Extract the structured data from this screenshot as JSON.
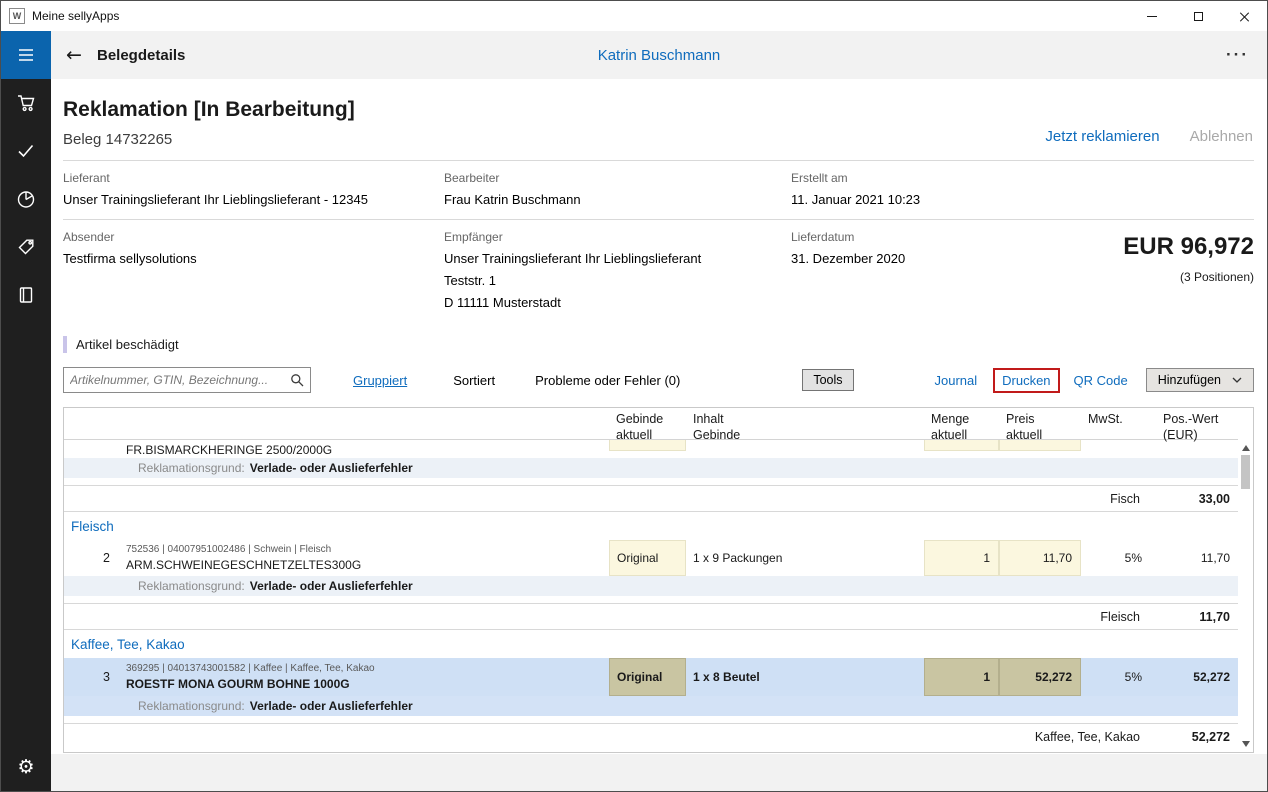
{
  "titlebar": {
    "app_icon": "W",
    "title": "Meine sellyApps"
  },
  "header": {
    "back": "←",
    "title": "Belegdetails",
    "user": "Katrin Buschmann",
    "more": "···"
  },
  "doc": {
    "title": "Reklamation [In Bearbeitung]",
    "beleg": "Beleg 14732265",
    "action_primary": "Jetzt reklamieren",
    "action_secondary": "Ablehnen",
    "note": "Artikel beschädigt",
    "total": "EUR 96,972",
    "total_positions": "(3 Positionen)",
    "fields": {
      "lieferant": {
        "label": "Lieferant",
        "value": "Unser Trainingslieferant Ihr Lieblingslieferant - 12345"
      },
      "bearbeiter": {
        "label": "Bearbeiter",
        "value": "Frau Katrin Buschmann"
      },
      "erstellt": {
        "label": "Erstellt am",
        "value": "11. Januar 2021 10:23"
      },
      "absender": {
        "label": "Absender",
        "value": "Testfirma sellysolutions"
      },
      "empfaenger": {
        "label": "Empfänger",
        "line1": "Unser Trainingslieferant Ihr Lieblingslieferant",
        "line2": "Teststr. 1",
        "line3": "D 11111 Musterstadt"
      },
      "lieferdatum": {
        "label": "Lieferdatum",
        "value": "31. Dezember 2020"
      }
    }
  },
  "toolbar": {
    "search_placeholder": "Artikelnummer, GTIN, Bezeichnung...",
    "gruppiert": "Gruppiert",
    "sortiert": "Sortiert",
    "probleme": "Probleme oder Fehler (0)",
    "tools": "Tools",
    "journal": "Journal",
    "drucken": "Drucken",
    "qr_code": "QR Code",
    "hinzufuegen": "Hinzufügen"
  },
  "table": {
    "headers": {
      "gebinde": "Gebinde aktuell",
      "inhalt": "Inhalt Gebinde",
      "menge": "Menge aktuell",
      "preis": "Preis aktuell",
      "mwst": "MwSt.",
      "poswert": "Pos.-Wert (EUR)"
    },
    "reason_label": "Reklamationsgrund:",
    "rows": {
      "r1": {
        "name": "FR.BISMARCKHERINGE 2500/2000G",
        "reason": "Verlade- oder Auslieferfehler"
      },
      "fisch_total": {
        "label": "Fisch",
        "value": "33,00"
      },
      "fleisch_group": "Fleisch",
      "r2": {
        "num": "2",
        "meta": "752536 | 04007951002486 | Schwein | Fleisch",
        "name": "ARM.SCHWEINEGESCHNETZELTES300G",
        "gebinde": "Original",
        "inhalt": "1 x 9 Packungen",
        "menge": "1",
        "preis": "11,70",
        "mwst": "5%",
        "wert": "11,70",
        "reason": "Verlade- oder Auslieferfehler"
      },
      "fleisch_total": {
        "label": "Fleisch",
        "value": "11,70"
      },
      "kaffee_group": "Kaffee, Tee, Kakao",
      "r3": {
        "num": "3",
        "meta": "369295 | 04013743001582 | Kaffee | Kaffee, Tee, Kakao",
        "name": "ROESTF MONA GOURM BOHNE 1000G",
        "gebinde": "Original",
        "inhalt": "1 x 8 Beutel",
        "menge": "1",
        "preis": "52,272",
        "mwst": "5%",
        "wert": "52,272",
        "reason": "Verlade- oder Auslieferfehler"
      },
      "kaffee_total": {
        "label": "Kaffee, Tee, Kakao",
        "value": "52,272"
      }
    }
  }
}
